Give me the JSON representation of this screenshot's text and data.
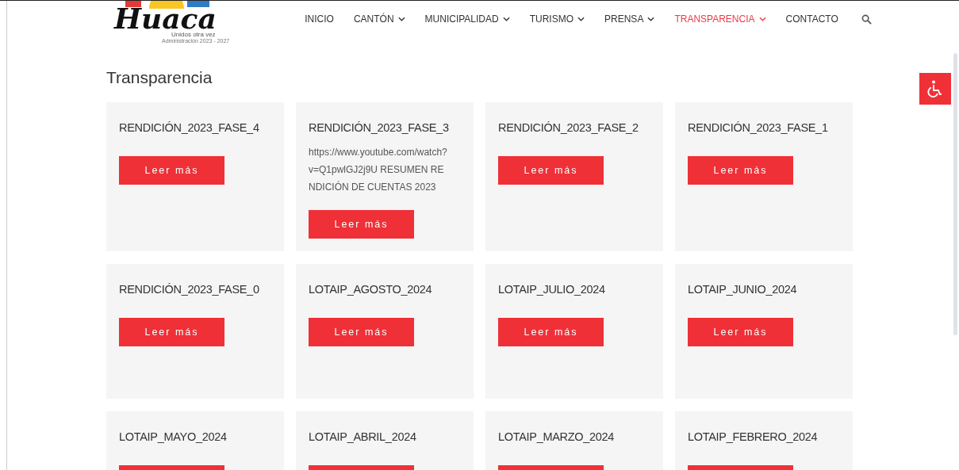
{
  "logo": {
    "name": "Huaca",
    "slogan": "Unidos otra vez",
    "subtitle": "Administración 2023 - 2027"
  },
  "nav": [
    {
      "label": "INICIO",
      "dropdown": false,
      "selected": false
    },
    {
      "label": "CANTÓN",
      "dropdown": true,
      "selected": false
    },
    {
      "label": "MUNICIPALIDAD",
      "dropdown": true,
      "selected": false
    },
    {
      "label": "TURISMO",
      "dropdown": true,
      "selected": false
    },
    {
      "label": "PRENSA",
      "dropdown": true,
      "selected": false
    },
    {
      "label": "TRANSPARENCIA",
      "dropdown": true,
      "selected": true
    },
    {
      "label": "CONTACTO",
      "dropdown": false,
      "selected": false
    }
  ],
  "page_title": "Transparencia",
  "cards": [
    {
      "title": "RENDICIÓN_2023_FASE_4",
      "button": "Leer más"
    },
    {
      "title": "RENDICIÓN_2023_FASE_3",
      "excerpt": "https://www.youtube.com/watch?v=Q1pwlGJ2j9U RESUMEN RENDICIÓN DE CUENTAS 2023",
      "button": "Leer más"
    },
    {
      "title": "RENDICIÓN_2023_FASE_2",
      "button": "Leer más"
    },
    {
      "title": "RENDICIÓN_2023_FASE_1",
      "button": "Leer más"
    },
    {
      "title": "RENDICIÓN_2023_FASE_0",
      "button": "Leer más"
    },
    {
      "title": "LOTAIP_AGOSTO_2024",
      "button": "Leer más"
    },
    {
      "title": "LOTAIP_JULIO_2024",
      "button": "Leer más"
    },
    {
      "title": "LOTAIP_JUNIO_2024",
      "button": "Leer más"
    },
    {
      "title": "LOTAIP_MAYO_2024",
      "has_button": true
    },
    {
      "title": "LOTAIP_ABRIL_2024",
      "has_button": true
    },
    {
      "title": "LOTAIP_MARZO_2024",
      "has_button": true
    },
    {
      "title": "LOTAIP_FEBRERO_2024",
      "has_button": true
    }
  ]
}
